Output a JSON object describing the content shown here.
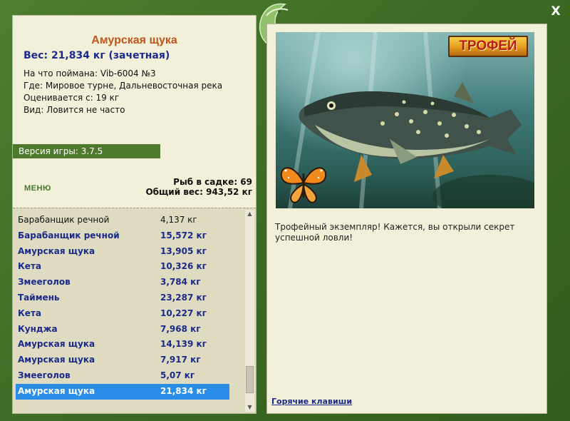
{
  "window": {
    "close_label": "X"
  },
  "fish": {
    "name": "Амурская щука",
    "weight": "Вес: 21,834 кг (зачетная)",
    "bait": "На что поймана: Vib-6004 №3",
    "location": "Где: Мировое турне, Дальневосточная река",
    "rated_from": "Оценивается с: 19 кг",
    "kind": "Вид: Ловится не часто"
  },
  "version": "Версия игры: 3.7.5",
  "menu_label": "МЕНЮ",
  "keepnet": {
    "count": "Рыб в садке: 69",
    "total_weight": "Общий вес: 943,52 кг"
  },
  "catch_list": [
    {
      "name": "Барабанщик речной",
      "weight": "4,137 кг",
      "style": "normal"
    },
    {
      "name": "Барабанщик речной",
      "weight": "15,572 кг",
      "style": "trophy"
    },
    {
      "name": "Амурская щука",
      "weight": "13,905 кг",
      "style": "trophy"
    },
    {
      "name": "Кета",
      "weight": "10,326 кг",
      "style": "trophy"
    },
    {
      "name": "Змееголов",
      "weight": "3,784 кг",
      "style": "trophy"
    },
    {
      "name": "Таймень",
      "weight": "23,287 кг",
      "style": "trophy"
    },
    {
      "name": "Кета",
      "weight": "10,227 кг",
      "style": "trophy"
    },
    {
      "name": "Кунджа",
      "weight": "7,968 кг",
      "style": "trophy"
    },
    {
      "name": "Амурская щука",
      "weight": "14,139 кг",
      "style": "trophy"
    },
    {
      "name": "Амурская щука",
      "weight": "7,917 кг",
      "style": "trophy"
    },
    {
      "name": "Змееголов",
      "weight": "5,07 кг",
      "style": "trophy"
    },
    {
      "name": "Амурская щука",
      "weight": "21,834 кг",
      "style": "selected"
    }
  ],
  "trophy_badge": "ТРОФЕЙ",
  "description": "Трофейный экземпляр! Кажется, вы открыли секрет успешной ловли!",
  "hotkeys_label": "Горячие клавиши",
  "colors": {
    "frame_green": "#3f6e27",
    "panel_bg": "#f3f0da",
    "title_orange": "#c0561c",
    "trophy_blue": "#1b2a8a",
    "selected_bg": "#2a8de8"
  }
}
